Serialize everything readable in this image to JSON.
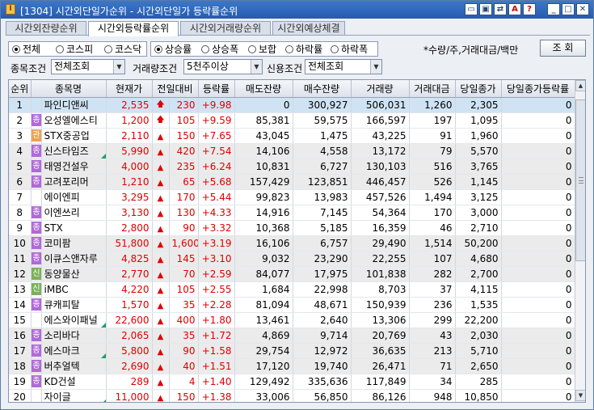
{
  "window": {
    "title": "[1304]  시간외단일가순위 - 시간외단일가 등락률순위",
    "controls": [
      "restore-small",
      "tile",
      "link",
      "A",
      "?",
      "minimize",
      "maximize",
      "close"
    ],
    "accent": "#3d78c8"
  },
  "tabs": [
    {
      "label": "시간외잔량순위",
      "active": false
    },
    {
      "label": "시간외등락률순위",
      "active": true
    },
    {
      "label": "시간외거래량순위",
      "active": false
    },
    {
      "label": "시간외예상체결",
      "active": false
    }
  ],
  "market_group": [
    {
      "label": "전체",
      "selected": true
    },
    {
      "label": "코스피",
      "selected": false
    },
    {
      "label": "코스닥",
      "selected": false
    }
  ],
  "sort_group": [
    {
      "label": "상승률",
      "selected": true
    },
    {
      "label": "상승폭",
      "selected": false
    },
    {
      "label": "보합",
      "selected": false
    },
    {
      "label": "하락률",
      "selected": false
    },
    {
      "label": "하락폭",
      "selected": false
    }
  ],
  "unit_note": "*수량/주,거래대금/백만",
  "query_button": "조  회",
  "filters": {
    "item_label": "종목조건",
    "item_value": "전체조회",
    "volume_label": "거래량조건",
    "volume_value": "5천주이상",
    "credit_label": "신용조건",
    "credit_value": "전체조회"
  },
  "columns": [
    "순위",
    "종목명",
    "현재가",
    "전일대비",
    "등락률",
    "매도잔량",
    "매수잔량",
    "거래량",
    "거래대금",
    "당일종가",
    "당일종가등락률"
  ],
  "colors": {
    "up": "#e00000",
    "rise_badge": "#b06ad8",
    "manage_badge": "#f0a050",
    "new_badge": "#7cb05a",
    "selected_row": "#cfe3f4"
  },
  "rows": [
    {
      "rank": "1",
      "badge": "",
      "name": "파인디앤씨",
      "tri": false,
      "price": "2,535",
      "arrow": "up-arrow",
      "chg": "230",
      "rate": "+9.98",
      "sell": "0",
      "buy": "300,927",
      "vol": "506,031",
      "amt": "1,260",
      "close": "2,305",
      "closerate": "0"
    },
    {
      "rank": "2",
      "badge": "종",
      "name": "오성엘에스티",
      "tri": false,
      "price": "1,200",
      "arrow": "up-arrow",
      "chg": "105",
      "rate": "+9.59",
      "sell": "85,381",
      "buy": "59,575",
      "vol": "166,597",
      "amt": "197",
      "close": "1,095",
      "closerate": "0"
    },
    {
      "rank": "3",
      "badge": "관",
      "name": "STX중공업",
      "tri": false,
      "price": "2,110",
      "arrow": "triangle",
      "chg": "150",
      "rate": "+7.65",
      "sell": "43,045",
      "buy": "1,475",
      "vol": "43,225",
      "amt": "91",
      "close": "1,960",
      "closerate": "0"
    },
    {
      "rank": "4",
      "badge": "종",
      "name": "신스타임즈",
      "tri": true,
      "price": "5,990",
      "arrow": "triangle",
      "chg": "420",
      "rate": "+7.54",
      "sell": "14,106",
      "buy": "4,558",
      "vol": "13,172",
      "amt": "79",
      "close": "5,570",
      "closerate": "0"
    },
    {
      "rank": "5",
      "badge": "종",
      "name": "태영건설우",
      "tri": false,
      "price": "4,000",
      "arrow": "triangle",
      "chg": "235",
      "rate": "+6.24",
      "sell": "10,831",
      "buy": "6,727",
      "vol": "130,103",
      "amt": "516",
      "close": "3,765",
      "closerate": "0"
    },
    {
      "rank": "6",
      "badge": "종",
      "name": "고려포리머",
      "tri": false,
      "price": "1,210",
      "arrow": "triangle",
      "chg": "65",
      "rate": "+5.68",
      "sell": "157,429",
      "buy": "123,851",
      "vol": "446,457",
      "amt": "526",
      "close": "1,145",
      "closerate": "0"
    },
    {
      "rank": "7",
      "badge": "",
      "name": "에이엔피",
      "tri": false,
      "price": "3,295",
      "arrow": "triangle",
      "chg": "170",
      "rate": "+5.44",
      "sell": "99,823",
      "buy": "13,983",
      "vol": "457,526",
      "amt": "1,494",
      "close": "3,125",
      "closerate": "0"
    },
    {
      "rank": "8",
      "badge": "종",
      "name": "이엔쓰리",
      "tri": false,
      "price": "3,130",
      "arrow": "triangle",
      "chg": "130",
      "rate": "+4.33",
      "sell": "14,916",
      "buy": "7,145",
      "vol": "54,364",
      "amt": "170",
      "close": "3,000",
      "closerate": "0"
    },
    {
      "rank": "9",
      "badge": "종",
      "name": "STX",
      "tri": false,
      "price": "2,800",
      "arrow": "triangle",
      "chg": "90",
      "rate": "+3.32",
      "sell": "10,368",
      "buy": "5,185",
      "vol": "16,359",
      "amt": "46",
      "close": "2,710",
      "closerate": "0"
    },
    {
      "rank": "10",
      "badge": "종",
      "name": "코미팜",
      "tri": false,
      "price": "51,800",
      "arrow": "triangle",
      "chg": "1,600",
      "rate": "+3.19",
      "sell": "16,106",
      "buy": "6,757",
      "vol": "29,490",
      "amt": "1,514",
      "close": "50,200",
      "closerate": "0"
    },
    {
      "rank": "11",
      "badge": "종",
      "name": "이큐스앤자루",
      "tri": false,
      "price": "4,825",
      "arrow": "triangle",
      "chg": "145",
      "rate": "+3.10",
      "sell": "9,032",
      "buy": "23,290",
      "vol": "22,255",
      "amt": "107",
      "close": "4,680",
      "closerate": "0"
    },
    {
      "rank": "12",
      "badge": "신",
      "name": "동양물산",
      "tri": false,
      "price": "2,770",
      "arrow": "triangle",
      "chg": "70",
      "rate": "+2.59",
      "sell": "84,077",
      "buy": "17,975",
      "vol": "101,838",
      "amt": "282",
      "close": "2,700",
      "closerate": "0"
    },
    {
      "rank": "13",
      "badge": "신",
      "name": "iMBC",
      "tri": false,
      "price": "4,220",
      "arrow": "triangle",
      "chg": "105",
      "rate": "+2.55",
      "sell": "1,684",
      "buy": "22,998",
      "vol": "8,703",
      "amt": "37",
      "close": "4,115",
      "closerate": "0"
    },
    {
      "rank": "14",
      "badge": "종",
      "name": "큐캐피탈",
      "tri": false,
      "price": "1,570",
      "arrow": "triangle",
      "chg": "35",
      "rate": "+2.28",
      "sell": "81,094",
      "buy": "48,671",
      "vol": "150,939",
      "amt": "236",
      "close": "1,535",
      "closerate": "0"
    },
    {
      "rank": "15",
      "badge": "",
      "name": "에스와이패널",
      "tri": true,
      "price": "22,600",
      "arrow": "triangle",
      "chg": "400",
      "rate": "+1.80",
      "sell": "13,461",
      "buy": "2,640",
      "vol": "13,306",
      "amt": "299",
      "close": "22,200",
      "closerate": "0"
    },
    {
      "rank": "16",
      "badge": "종",
      "name": "소리바다",
      "tri": false,
      "price": "2,065",
      "arrow": "triangle",
      "chg": "35",
      "rate": "+1.72",
      "sell": "4,869",
      "buy": "9,714",
      "vol": "20,769",
      "amt": "43",
      "close": "2,030",
      "closerate": "0"
    },
    {
      "rank": "17",
      "badge": "종",
      "name": "에스마크",
      "tri": true,
      "price": "5,800",
      "arrow": "triangle",
      "chg": "90",
      "rate": "+1.58",
      "sell": "29,754",
      "buy": "12,972",
      "vol": "36,635",
      "amt": "213",
      "close": "5,710",
      "closerate": "0"
    },
    {
      "rank": "18",
      "badge": "종",
      "name": "버추얼텍",
      "tri": false,
      "price": "2,690",
      "arrow": "triangle",
      "chg": "40",
      "rate": "+1.51",
      "sell": "17,120",
      "buy": "19,740",
      "vol": "26,471",
      "amt": "71",
      "close": "2,650",
      "closerate": "0"
    },
    {
      "rank": "19",
      "badge": "종",
      "name": "KD건설",
      "tri": false,
      "price": "289",
      "arrow": "triangle",
      "chg": "4",
      "rate": "+1.40",
      "sell": "129,492",
      "buy": "335,636",
      "vol": "117,849",
      "amt": "34",
      "close": "285",
      "closerate": "0"
    },
    {
      "rank": "20",
      "badge": "",
      "name": "자이글",
      "tri": true,
      "price": "11,000",
      "arrow": "triangle",
      "chg": "150",
      "rate": "+1.38",
      "sell": "33,006",
      "buy": "56,850",
      "vol": "86,126",
      "amt": "948",
      "close": "10,850",
      "closerate": "0"
    }
  ]
}
